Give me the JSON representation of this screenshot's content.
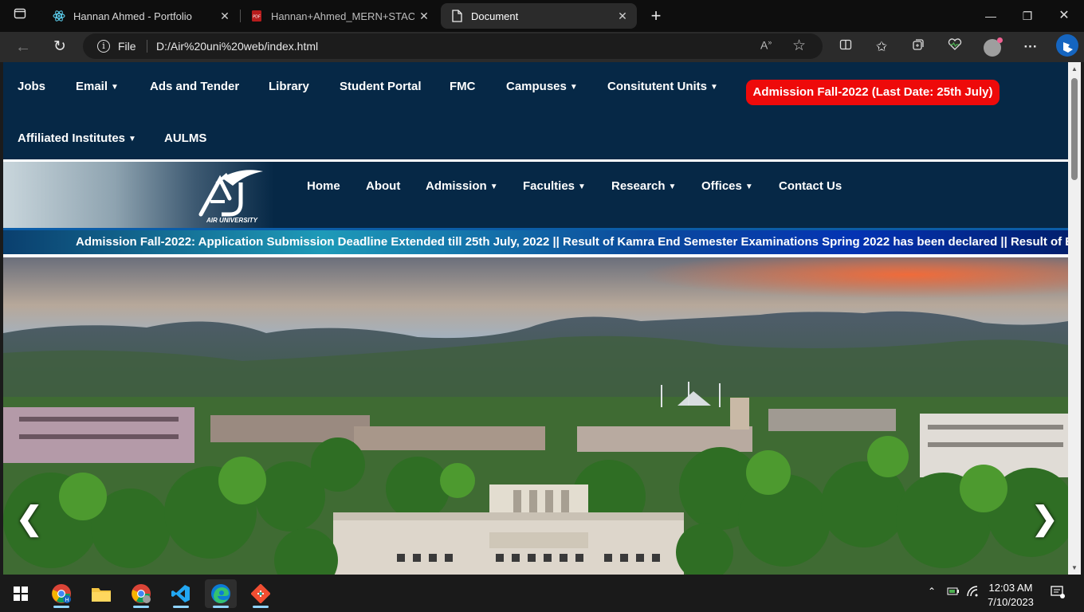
{
  "browser": {
    "tabs": [
      {
        "label": "Hannan Ahmed - Portfolio",
        "icon": "react-icon",
        "active": false
      },
      {
        "label": "Hannan+Ahmed_MERN+STACK.",
        "icon": "pdf-icon",
        "active": false
      },
      {
        "label": "Document",
        "icon": "document-icon",
        "active": true
      }
    ],
    "address": {
      "scheme_label": "File",
      "url": "D:/Air%20uni%20web/index.html"
    }
  },
  "topnav": {
    "items": [
      {
        "label": "Jobs",
        "dropdown": false
      },
      {
        "label": "Email",
        "dropdown": true
      },
      {
        "label": "Ads and Tender",
        "dropdown": false
      },
      {
        "label": "Library",
        "dropdown": false
      },
      {
        "label": "Student Portal",
        "dropdown": false
      },
      {
        "label": "FMC",
        "dropdown": false
      },
      {
        "label": "Campuses",
        "dropdown": true
      },
      {
        "label": "Consitutent Units",
        "dropdown": true
      },
      {
        "label": "Affiliated Institutes",
        "dropdown": true
      },
      {
        "label": "AULMS",
        "dropdown": false
      }
    ],
    "admission_button": "Admission Fall-2022 (Last Date: 25th July)"
  },
  "logo": {
    "text": "AIR UNIVERSITY"
  },
  "mainnav": {
    "items": [
      {
        "label": "Home",
        "dropdown": false
      },
      {
        "label": "About",
        "dropdown": false
      },
      {
        "label": "Admission",
        "dropdown": true
      },
      {
        "label": "Faculties",
        "dropdown": true
      },
      {
        "label": "Research",
        "dropdown": true
      },
      {
        "label": "Offices",
        "dropdown": true
      },
      {
        "label": "Contact Us",
        "dropdown": false
      }
    ]
  },
  "ticker": {
    "text": "Admission Fall-2022: Application Submission Deadline Extended till 25th July, 2022 || Result of Kamra End Semester Examinations Spring 2022 has been declared || Result of End S"
  },
  "hero": {
    "prev": "❮",
    "next": "❯"
  },
  "taskbar": {
    "time": "12:03 AM",
    "date": "7/10/2023"
  },
  "colors": {
    "nav_bg": "#062846",
    "admission_red": "#ee0a0a",
    "ticker_blue": "#0b4a9c"
  }
}
